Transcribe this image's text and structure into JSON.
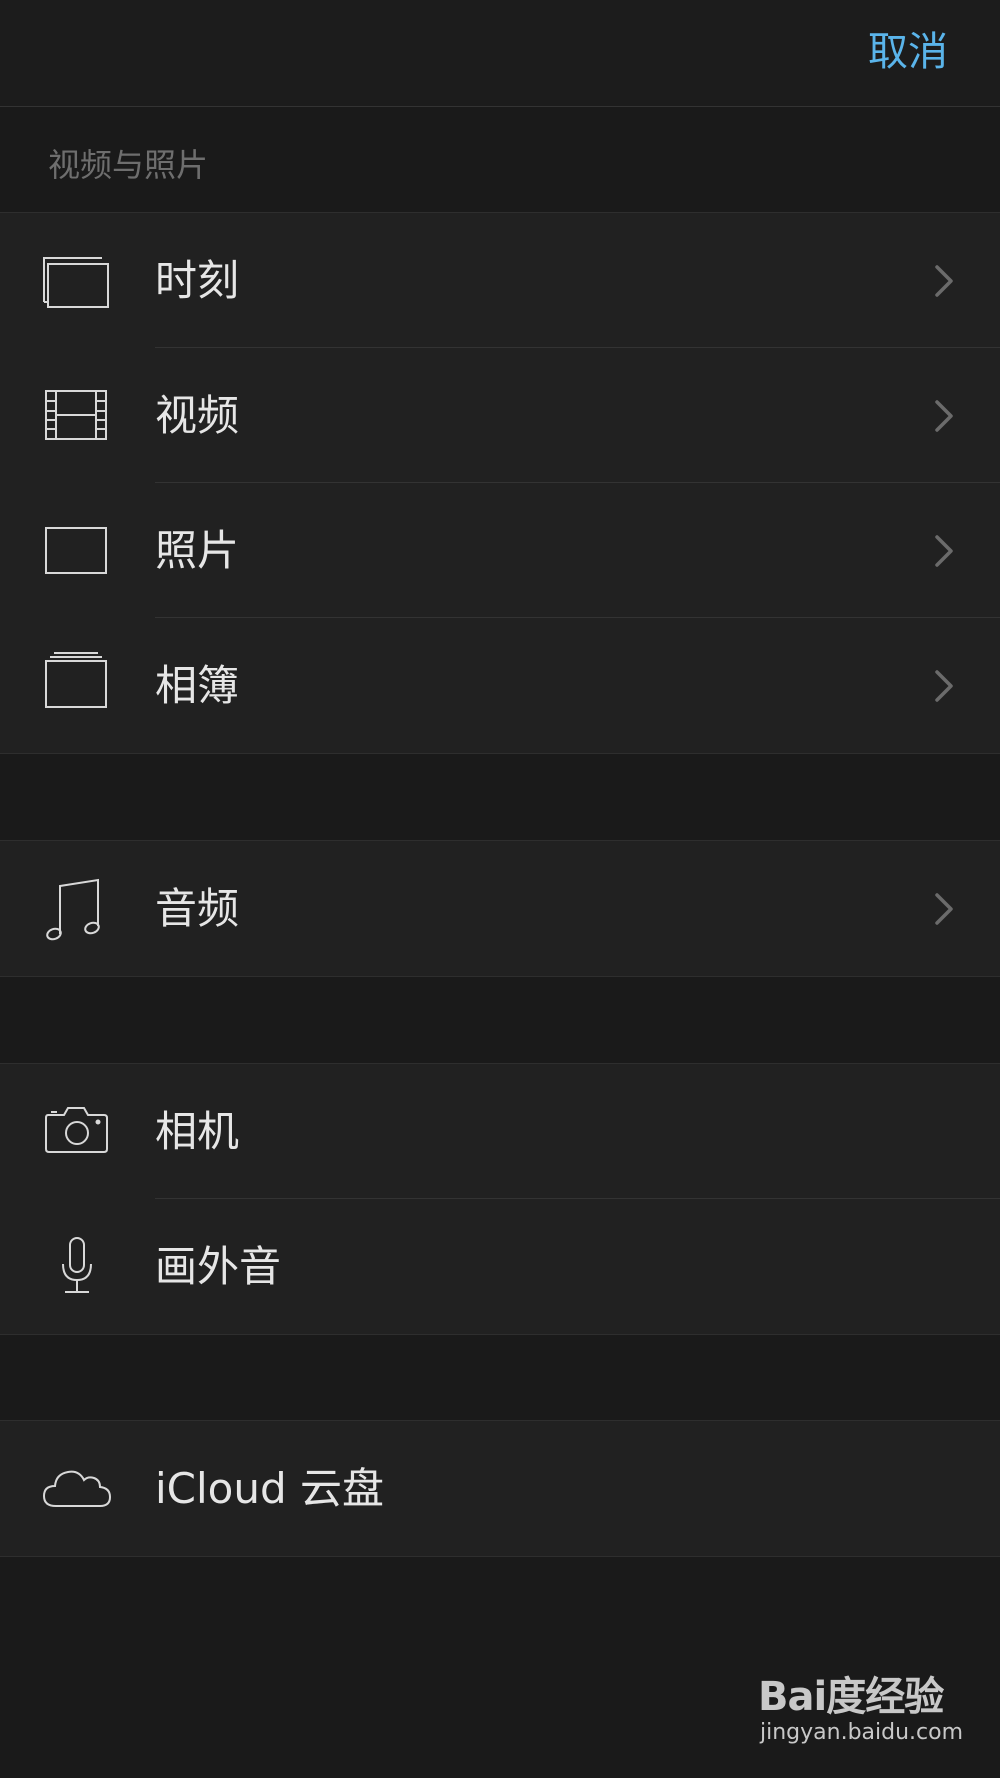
{
  "header": {
    "cancel_label": "取消"
  },
  "section": {
    "title": "视频与照片"
  },
  "groups": {
    "media": [
      {
        "label": "时刻",
        "icon": "moments-icon"
      },
      {
        "label": "视频",
        "icon": "film-icon"
      },
      {
        "label": "照片",
        "icon": "photo-icon"
      },
      {
        "label": "相簿",
        "icon": "albums-icon"
      }
    ],
    "audio": [
      {
        "label": "音频",
        "icon": "music-note-icon"
      }
    ],
    "capture": [
      {
        "label": "相机",
        "icon": "camera-icon"
      },
      {
        "label": "画外音",
        "icon": "microphone-icon"
      }
    ],
    "cloud": [
      {
        "label": "iCloud 云盘",
        "icon": "cloud-icon"
      }
    ]
  },
  "watermark": {
    "brand": "Bai度经验",
    "url": "jingyan.baidu.com"
  },
  "colors": {
    "accent": "#5ab4ea",
    "background": "#1a1a1a",
    "row_background": "#212121",
    "text": "#e6e6e6",
    "muted_text": "#6e6e6e"
  }
}
